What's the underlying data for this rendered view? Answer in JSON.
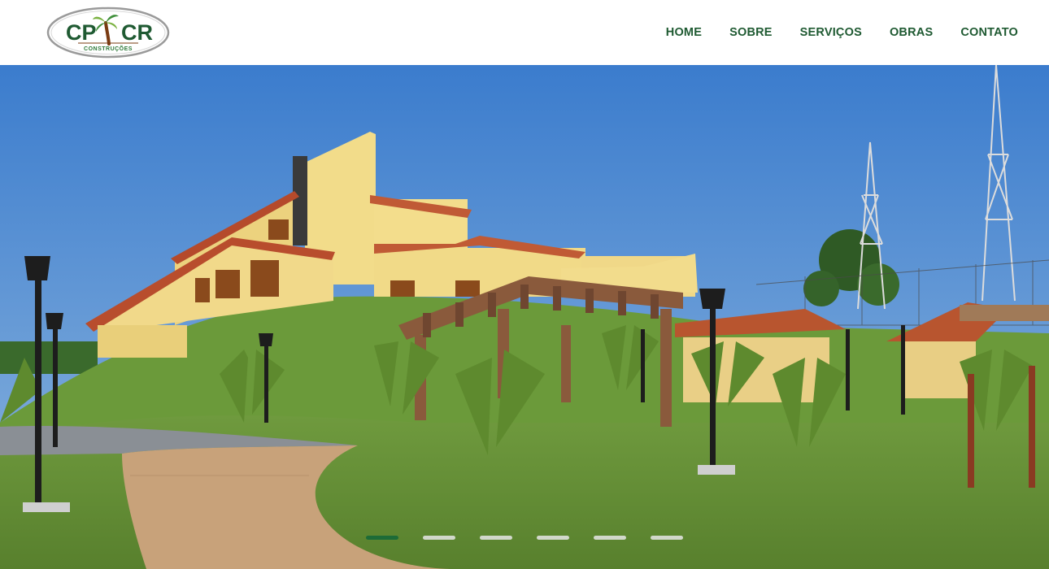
{
  "brand": {
    "logo_text_left": "CP",
    "logo_text_right": "CR",
    "logo_subtext": "CONSTRUÇÕES",
    "logo_icon": "palm-tree-icon",
    "colors": {
      "green": "#1f5a32",
      "brown": "#7a3b12",
      "lime": "#7bb241"
    }
  },
  "nav": {
    "items": [
      {
        "label": "HOME"
      },
      {
        "label": "SOBRE"
      },
      {
        "label": "SERVIÇOS"
      },
      {
        "label": "OBRAS"
      },
      {
        "label": "CONTATO"
      }
    ]
  },
  "slider": {
    "slide_count": 6,
    "active_index": 0,
    "active_color": "#1d6b37"
  }
}
